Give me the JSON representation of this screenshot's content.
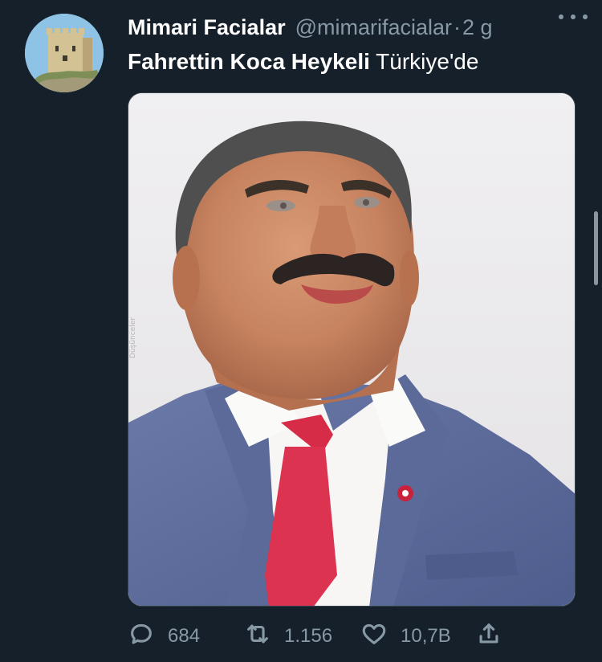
{
  "tweet": {
    "display_name": "Mimari Facialar",
    "handle": "@mimarifacialar",
    "separator": "·",
    "time": "2 g",
    "text_bold": "Fahrettin Koca Heykeli",
    "text_rest": " Türkiye'de",
    "more_icon": "more-horizontal-icon",
    "avatar_icon": "castle-tower-avatar",
    "media_watermark": "Düşünceler"
  },
  "actions": {
    "reply": {
      "icon": "reply-bubble-icon",
      "count": "684"
    },
    "retweet": {
      "icon": "retweet-icon",
      "count": "1.156"
    },
    "like": {
      "icon": "heart-icon",
      "count": "10,7B"
    },
    "share": {
      "icon": "share-icon"
    }
  },
  "colors": {
    "background": "#15202b",
    "primary_text": "#ffffff",
    "secondary_text": "#8899a6",
    "border": "#38444d",
    "scrollbar": "#8c959e"
  }
}
